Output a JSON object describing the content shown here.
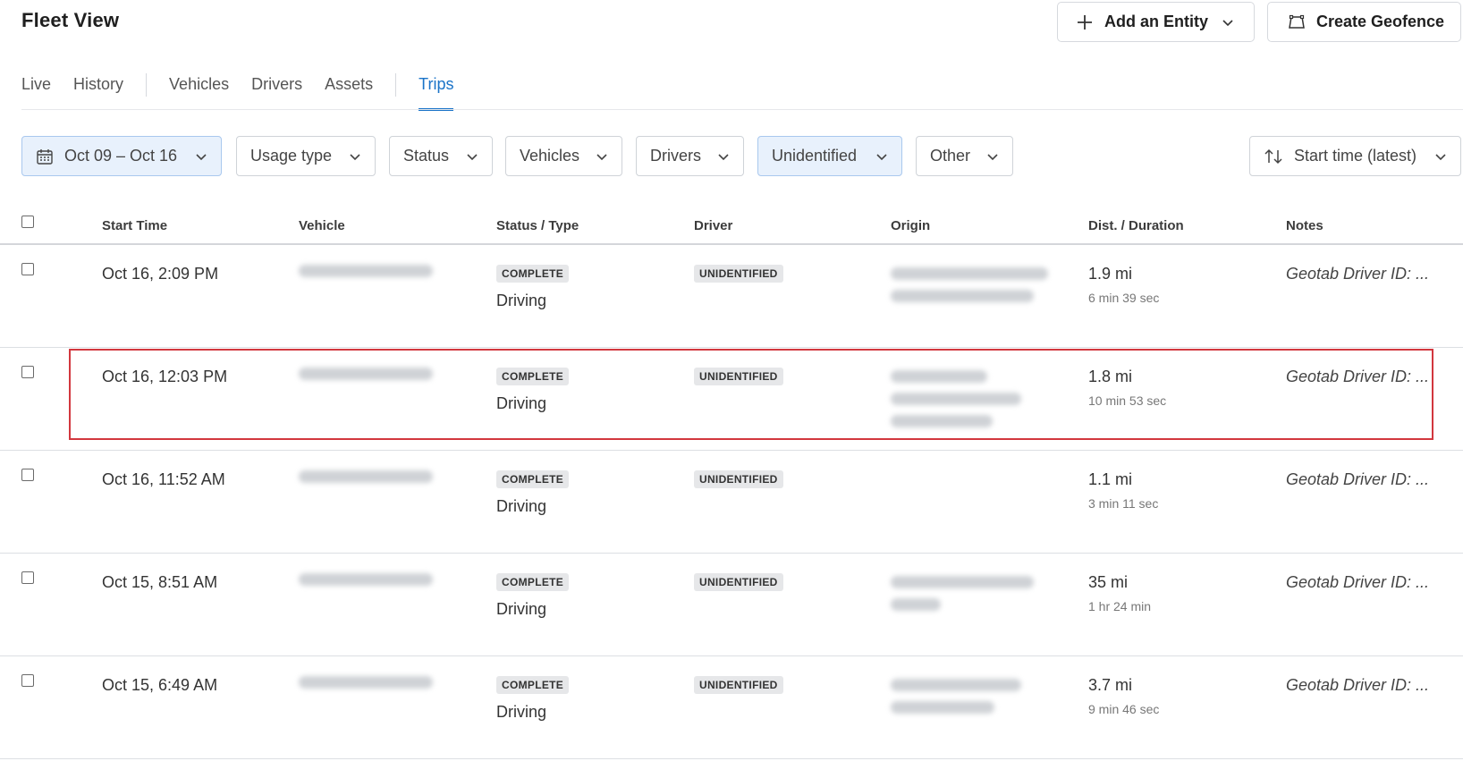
{
  "header": {
    "title": "Fleet View",
    "add_entity_label": "Add an Entity",
    "create_geofence_label": "Create Geofence"
  },
  "tabs": [
    {
      "label": "Live",
      "active": false
    },
    {
      "label": "History",
      "active": false
    },
    {
      "label": "Vehicles",
      "active": false
    },
    {
      "label": "Drivers",
      "active": false
    },
    {
      "label": "Assets",
      "active": false
    },
    {
      "label": "Trips",
      "active": true
    }
  ],
  "filters": {
    "date_range": "Oct 09 – Oct 16",
    "usage_type": "Usage type",
    "status": "Status",
    "vehicles": "Vehicles",
    "drivers": "Drivers",
    "unidentified": "Unidentified",
    "other": "Other",
    "sort": "Start time (latest)"
  },
  "table": {
    "columns": [
      "Start Time",
      "Vehicle",
      "Status / Type",
      "Driver",
      "Origin",
      "Dist. / Duration",
      "Notes"
    ],
    "rows": [
      {
        "start_time": "Oct 16, 2:09 PM",
        "status": "COMPLETE",
        "type": "Driving",
        "driver": "UNIDENTIFIED",
        "distance": "1.9 mi",
        "duration": "6 min 39 sec",
        "notes": "Geotab Driver ID: ...",
        "origin_lines": 2,
        "highlighted": false
      },
      {
        "start_time": "Oct 16, 12:03 PM",
        "status": "COMPLETE",
        "type": "Driving",
        "driver": "UNIDENTIFIED",
        "distance": "1.8 mi",
        "duration": "10 min 53 sec",
        "notes": "Geotab Driver ID: ...",
        "origin_lines": 3,
        "highlighted": true
      },
      {
        "start_time": "Oct 16, 11:52 AM",
        "status": "COMPLETE",
        "type": "Driving",
        "driver": "UNIDENTIFIED",
        "distance": "1.1 mi",
        "duration": "3 min 11 sec",
        "notes": "Geotab Driver ID: ...",
        "origin_lines": 0,
        "highlighted": false
      },
      {
        "start_time": "Oct 15, 8:51 AM",
        "status": "COMPLETE",
        "type": "Driving",
        "driver": "UNIDENTIFIED",
        "distance": "35 mi",
        "duration": "1 hr 24 min",
        "notes": "Geotab Driver ID: ...",
        "origin_lines": 2,
        "highlighted": false
      },
      {
        "start_time": "Oct 15, 6:49 AM",
        "status": "COMPLETE",
        "type": "Driving",
        "driver": "UNIDENTIFIED",
        "distance": "3.7 mi",
        "duration": "9 min 46 sec",
        "notes": "Geotab Driver ID: ...",
        "origin_lines": 2,
        "highlighted": false
      }
    ]
  },
  "colors": {
    "accent": "#1a73c8",
    "highlight_border": "#d2373e",
    "selected_filter_bg": "#e8f1fc"
  }
}
